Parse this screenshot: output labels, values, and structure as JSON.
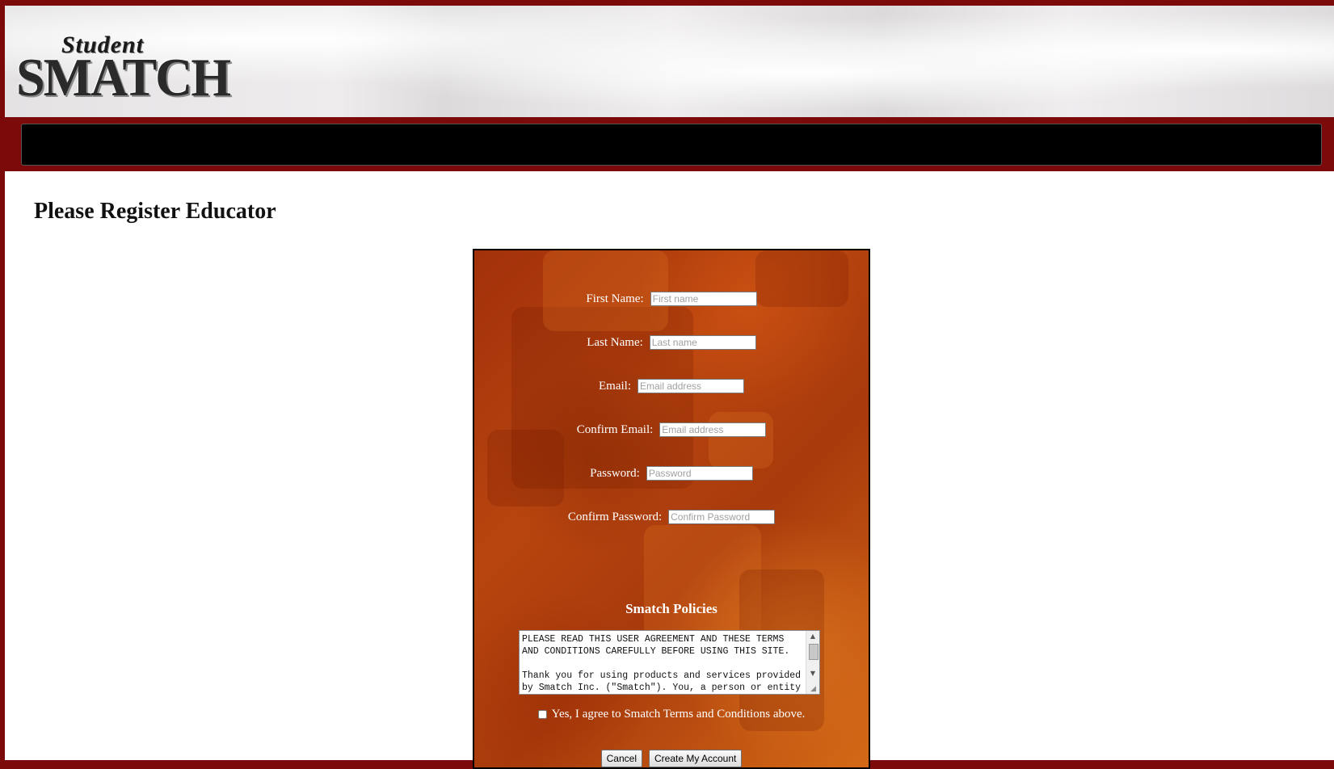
{
  "header": {
    "logo": {
      "line1": "Student",
      "line2": "SMATCH"
    }
  },
  "page": {
    "title": "Please Register Educator"
  },
  "form": {
    "fields": [
      {
        "label": "First Name:",
        "placeholder": "First name"
      },
      {
        "label": "Last Name:",
        "placeholder": "Last name"
      },
      {
        "label": "Email:",
        "placeholder": "Email address"
      },
      {
        "label": "Confirm Email:",
        "placeholder": "Email address"
      },
      {
        "label": "Password:",
        "placeholder": "Password"
      },
      {
        "label": "Confirm Password:",
        "placeholder": "Confirm Password"
      }
    ],
    "policies_title": "Smatch Policies",
    "terms_text": "PLEASE READ THIS USER AGREEMENT AND THESE TERMS\nAND CONDITIONS CAREFULLY BEFORE USING THIS SITE.\n\nThank you for using products and services provided\nby Smatch Inc. (\"Smatch\"). You, a person or entity",
    "agree_label": "Yes, I agree to Smatch Terms and Conditions above.",
    "cancel_label": "Cancel",
    "create_label": "Create My Account"
  },
  "colors": {
    "frame": "#7d0a0a",
    "navbar": "#000000",
    "form_bg": "#b8450f"
  },
  "icons": {
    "scroll_up": "▲",
    "scroll_down": "▼",
    "resize": "◢"
  }
}
